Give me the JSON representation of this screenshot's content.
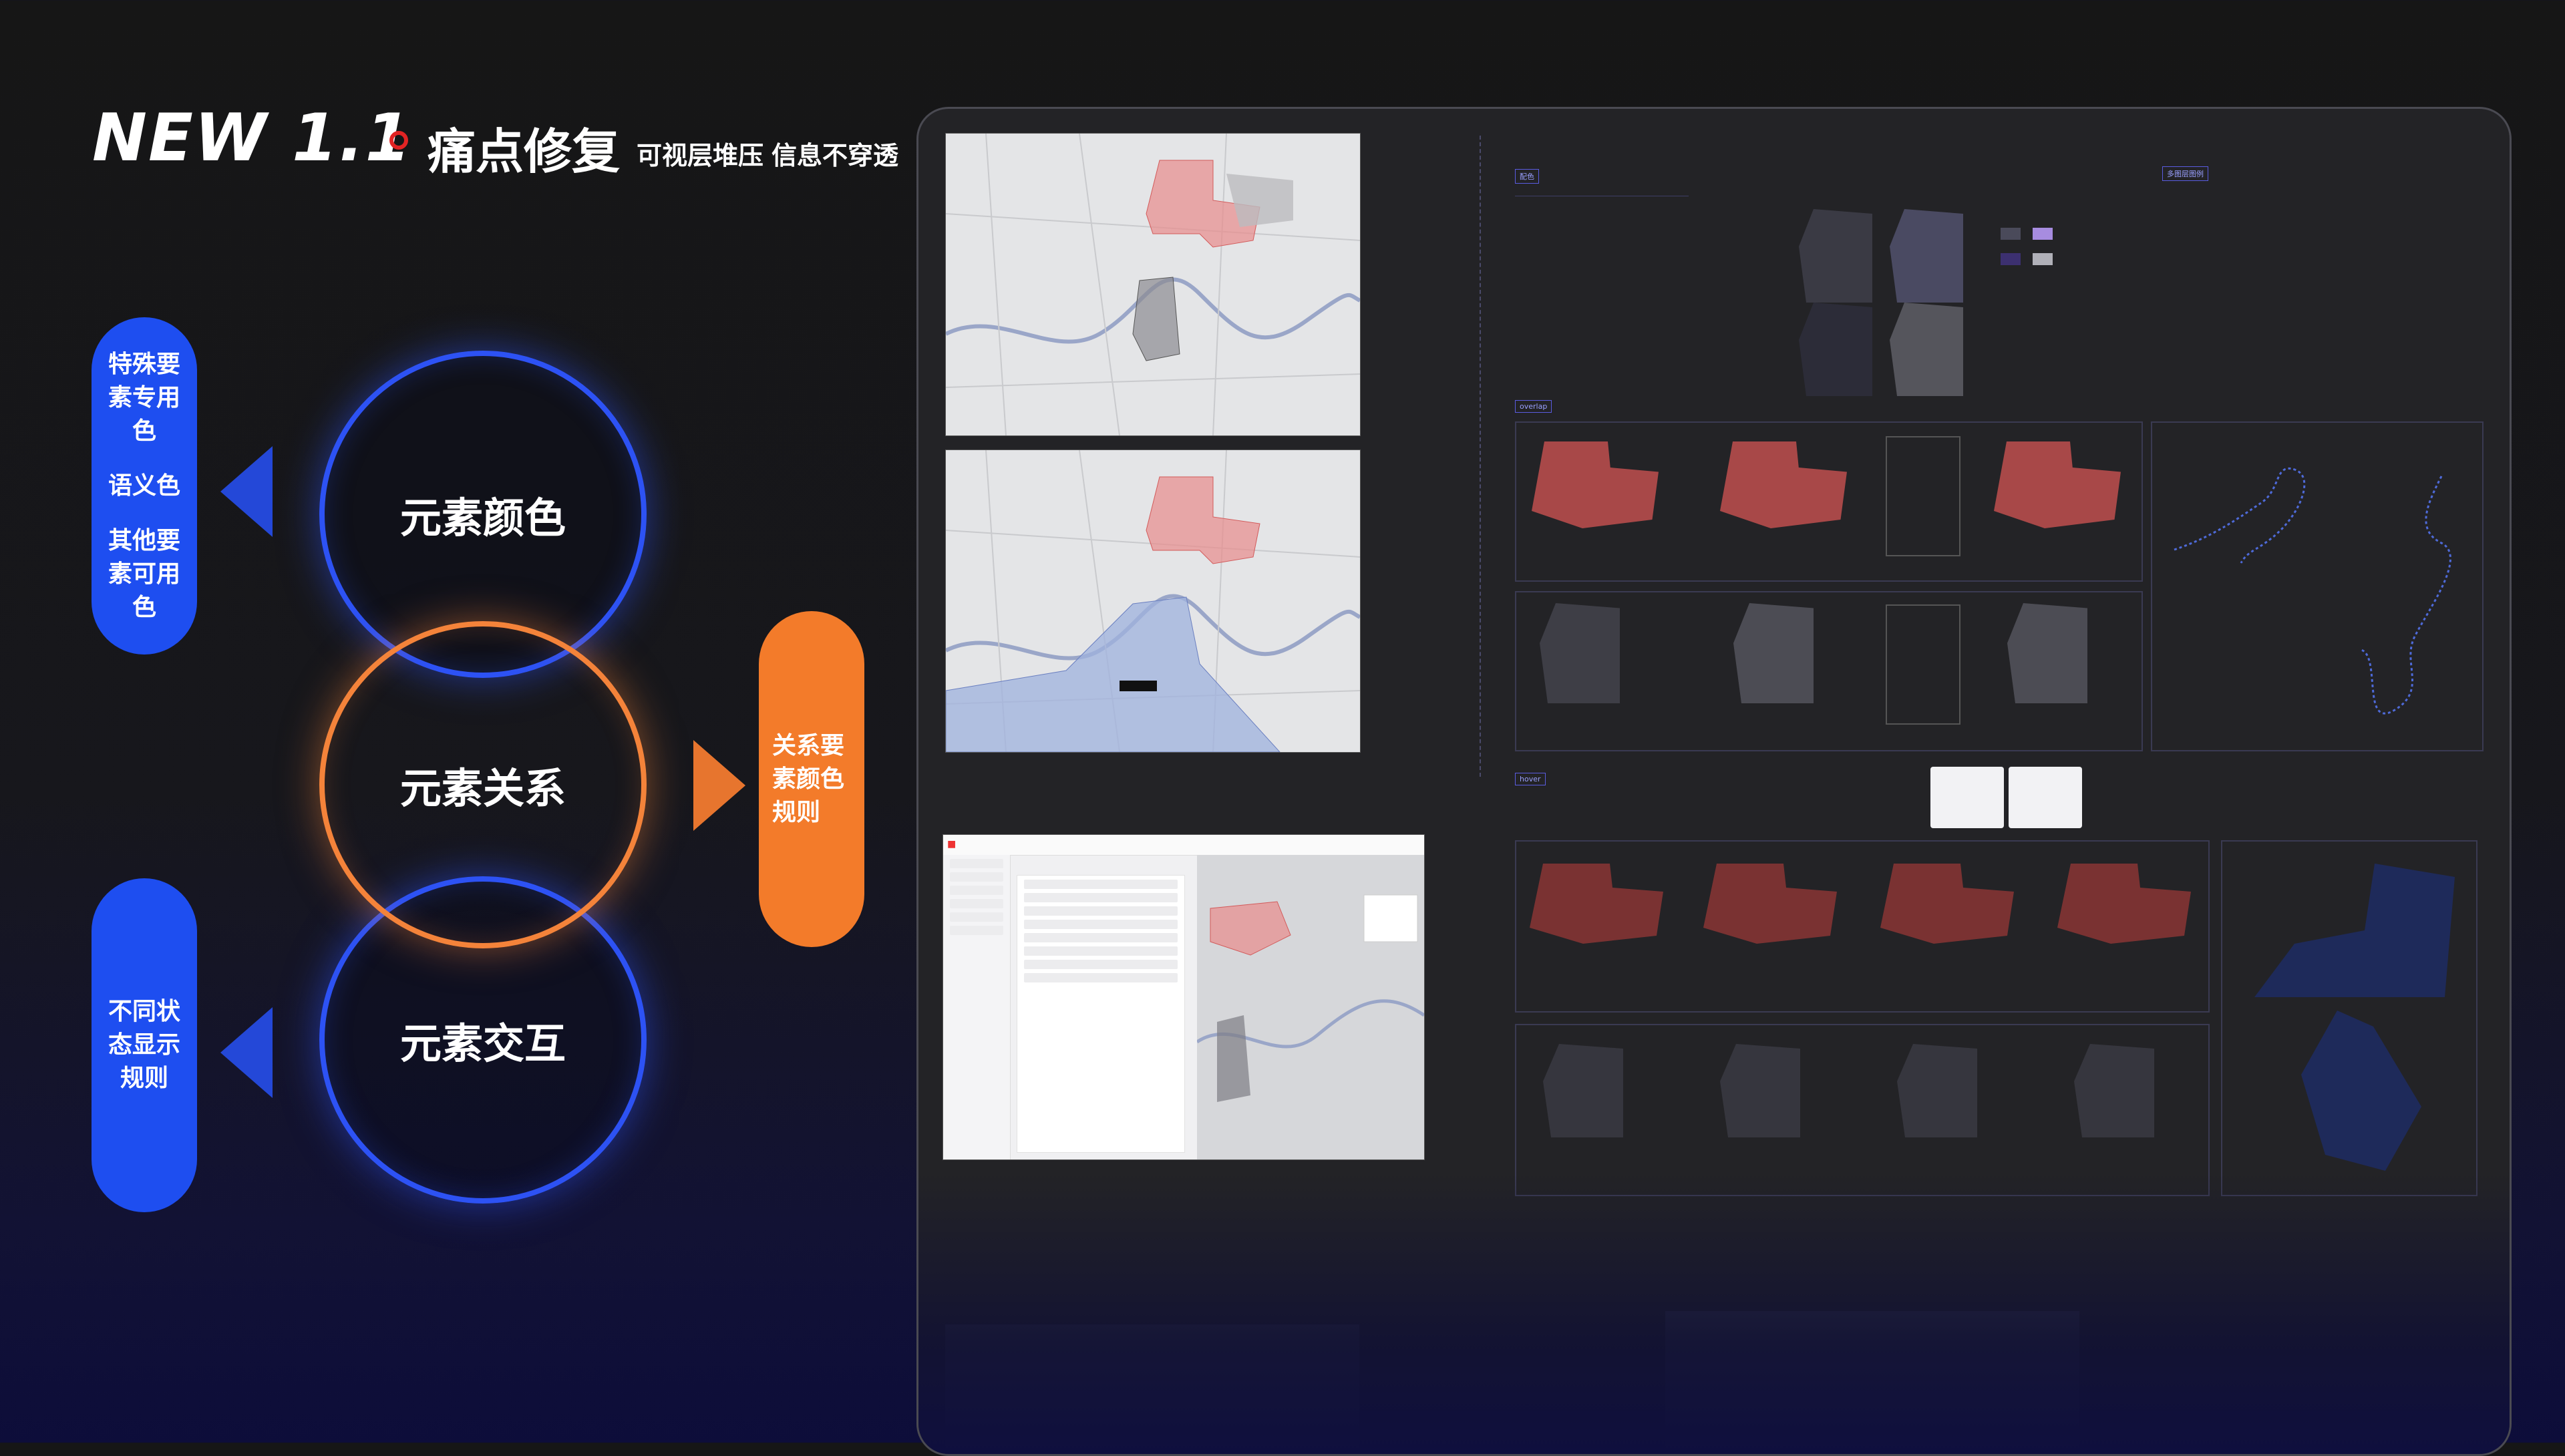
{
  "header": {
    "version": "NEW 1.1",
    "topic": "痛点修复",
    "subtitle_1": "可视层堆压",
    "subtitle_2": "信息不穿透"
  },
  "left_pills": {
    "top": [
      "特殊要",
      "素专用",
      "色",
      "语义色",
      "其他要",
      "素可用",
      "色"
    ],
    "bottom": [
      "不同状",
      "态显示",
      "规则"
    ]
  },
  "circles": {
    "color": "元素颜色",
    "relation": "元素关系",
    "interaction": "元素交互"
  },
  "right_pill": [
    "关系要",
    "素颜色",
    "规则"
  ],
  "panel": {
    "tag_color": "配色",
    "tag_overlap": "overlap",
    "tag_hover": "hover",
    "tag_legend": "多图层图例"
  },
  "colors": {
    "blue": "#1e4ef0",
    "orange": "#f37b2a",
    "red_dot": "#e22424",
    "map_red": "#e77b7b",
    "map_blue": "#7f9ad8"
  }
}
